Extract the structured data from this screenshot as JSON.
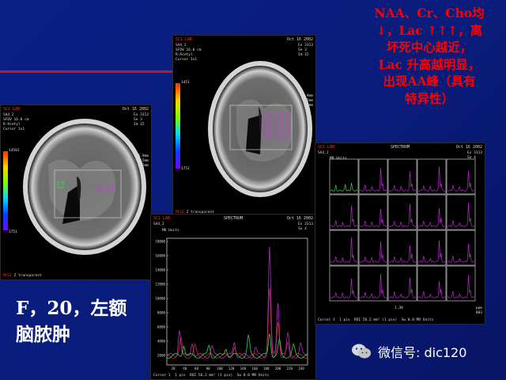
{
  "caption_lines": [
    "NAA、Cr、Cho均",
    "↓，Lac ↑↑↑，离",
    "坏死中心越近，",
    "Lac 升高越明显，",
    "出现AA峰（具有",
    "特异性）"
  ],
  "patient": {
    "line1": "F，20，左额",
    "line2": "脑脓肿"
  },
  "watermark": {
    "text": "微信号: dic120",
    "icon": "wechat-icon"
  },
  "mri_left": {
    "header_left": "SC1 LAB",
    "header_right": "Oct 16 2002",
    "meta_left": "SA4_2\nSFOV 16.0 cm\nR-Acetyl\nCursor 1x1",
    "meta_right": "Ex 3313\nSe 3\nIm 15",
    "readout": "L  6.9mm\nP 60.5mm\nS 44.2mm\n   004",
    "cbar_top": "14501",
    "cbar_bottom": "1751",
    "footer_lead": "MCSI",
    "footer": "Z transparent"
  },
  "mri_center": {
    "header_left": "SC1 LAB",
    "header_right": "Oct 16 2002",
    "meta_left": "SA4_2\nSFOV 16.0 cm\nR-Acetyl\nCursor 1x1",
    "meta_right": "Ex 3313\nSe 3\nIm 15",
    "readout": "L 41.9mm\nP 57.5mm\nS 44.2mm\n   004",
    "cbar_top": "1451",
    "cbar_bottom": "1751",
    "footer_lead": "MCSI",
    "footer": "Z transparent"
  },
  "spectrum_single": {
    "header_left": "SC1 LAB",
    "header_center": "SPECTRUM",
    "header_right": "Oct 16 2002",
    "meta_left": "SA4_2",
    "meta_right": "Ex 3313\nSe 4",
    "y_unit": "MR Units",
    "y_ticks": [
      "18000",
      "16000",
      "14000",
      "12000",
      "10000",
      "8000",
      "6000",
      "4000",
      "2000"
    ],
    "x_ticks": [
      "20",
      "40",
      "60",
      "80",
      "100",
      "120",
      "140",
      "160",
      "180",
      "200",
      "220",
      "240"
    ],
    "footer": "Cursor 1  1 pix  ROI 56.2 mm² (1 pix)  Sw 0.0 MR Units"
  },
  "spectrum_grid": {
    "header_left": "SC1 LAB",
    "header_center": "SPECTRUM",
    "header_right": "Oct 16 2002",
    "meta_left": "SA4_2",
    "meta_right": "Ex 3313\nSe 4",
    "y_unit": "MR Units",
    "ppm_label": "1.38",
    "footer": "Cursor 1  1 pix  ROI 56.2 mm² (1 pix)  Sw 0.0 MR Units",
    "footer_right": "ppm\n003"
  },
  "colors": {
    "background": "#0b1f86",
    "accent_red": "#ff0000",
    "purple": "#b42cc8",
    "green": "#3cd24a"
  }
}
